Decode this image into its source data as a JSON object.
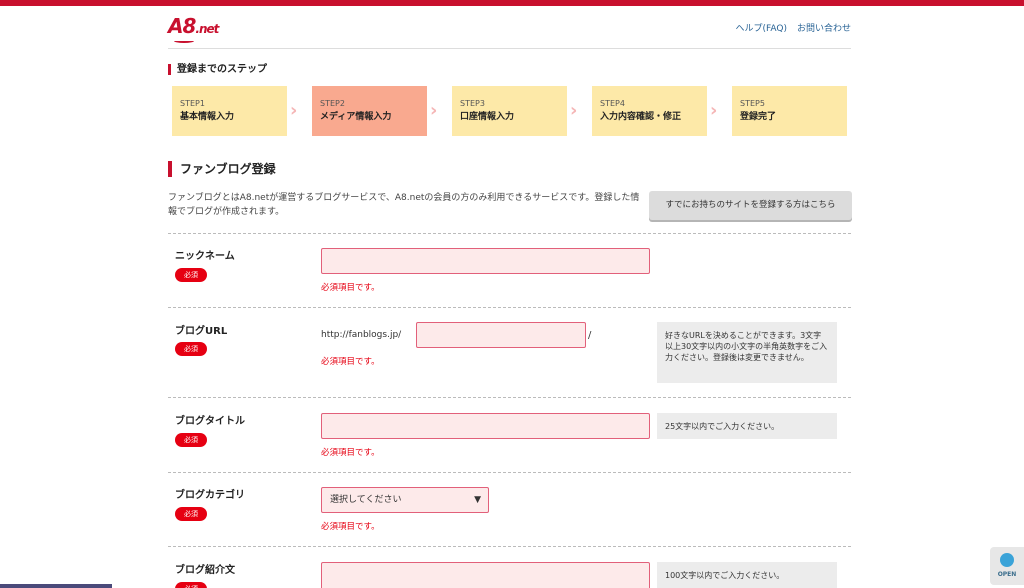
{
  "header": {
    "logo_text": "A8",
    "logo_suffix": ".net",
    "help_link": "ヘルプ(FAQ)",
    "contact_link": "お問い合わせ"
  },
  "steps_heading": "登録までのステップ",
  "steps": [
    {
      "num": "STEP1",
      "label": "基本情報入力"
    },
    {
      "num": "STEP2",
      "label": "メディア情報入力"
    },
    {
      "num": "STEP3",
      "label": "口座情報入力"
    },
    {
      "num": "STEP4",
      "label": "入力内容確認・修正"
    },
    {
      "num": "STEP5",
      "label": "登録完了"
    }
  ],
  "section": {
    "title": "ファンブログ登録",
    "intro": "ファンブログとはA8.netが運営するブログサービスで、A8.netの会員の方のみ利用できるサービスです。登録した情報でブログが作成されます。",
    "existing_button": "すでにお持ちのサイトを登録する方はこちら"
  },
  "form": {
    "required_badge": "必須",
    "required_error": "必須項目です。",
    "nickname": {
      "label": "ニックネーム",
      "value": ""
    },
    "blog_url": {
      "label": "ブログURL",
      "prefix": "http://fanblogs.jp/",
      "suffix": "/",
      "value": "",
      "note": "好きなURLを決めることができます。3文字以上30文字以内の小文字の半角英数字をご入力ください。登録後は変更できません。"
    },
    "blog_title": {
      "label": "ブログタイトル",
      "value": "",
      "note": "25文字以内でご入力ください。"
    },
    "blog_category": {
      "label": "ブログカテゴリ",
      "selected": "選択してください"
    },
    "blog_intro": {
      "label": "ブログ紹介文",
      "value": "",
      "note": "100文字以内でご入力ください。"
    }
  },
  "widget": {
    "label": "OPEN"
  },
  "colors": {
    "brand": "#c8102e",
    "step_bg": "#fde9a8",
    "step_active": "#f9a98f",
    "error": "#e60012"
  }
}
